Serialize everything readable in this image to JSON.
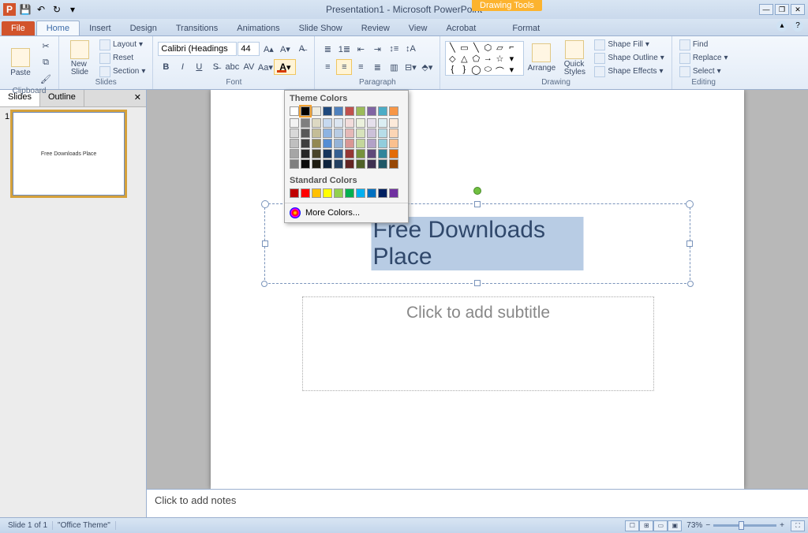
{
  "title": "Presentation1 - Microsoft PowerPoint",
  "context_tab": "Drawing Tools",
  "tabs": {
    "file": "File",
    "home": "Home",
    "insert": "Insert",
    "design": "Design",
    "transitions": "Transitions",
    "animations": "Animations",
    "slideshow": "Slide Show",
    "review": "Review",
    "view": "View",
    "acrobat": "Acrobat",
    "format": "Format"
  },
  "groups": {
    "clipboard": "Clipboard",
    "slides": "Slides",
    "font": "Font",
    "paragraph": "Paragraph",
    "drawing": "Drawing",
    "editing": "Editing"
  },
  "clipboard": {
    "paste": "Paste"
  },
  "slides": {
    "new": "New\nSlide",
    "layout": "Layout",
    "reset": "Reset",
    "section": "Section"
  },
  "font": {
    "name": "Calibri (Headings",
    "size": "44"
  },
  "drawing": {
    "arrange": "Arrange",
    "quick": "Quick\nStyles",
    "fill": "Shape Fill",
    "outline": "Shape Outline",
    "effects": "Shape Effects"
  },
  "editing": {
    "find": "Find",
    "replace": "Replace",
    "select": "Select"
  },
  "color_popup": {
    "theme_heading": "Theme Colors",
    "standard_heading": "Standard Colors",
    "more": "More Colors...",
    "theme_row": [
      "#ffffff",
      "#000000",
      "#eeece1",
      "#1f497d",
      "#4f81bd",
      "#c0504d",
      "#9bbb59",
      "#8064a2",
      "#4bacc6",
      "#f79646"
    ],
    "theme_tints": [
      [
        "#f2f2f2",
        "#7f7f7f",
        "#ddd9c3",
        "#c6d9f0",
        "#dbe5f1",
        "#f2dcdb",
        "#ebf1dd",
        "#e5e0ec",
        "#dbeef3",
        "#fdeada"
      ],
      [
        "#d8d8d8",
        "#595959",
        "#c4bd97",
        "#8db3e2",
        "#b8cce4",
        "#e5b9b7",
        "#d7e3bc",
        "#ccc1d9",
        "#b7dde8",
        "#fbd5b5"
      ],
      [
        "#bfbfbf",
        "#3f3f3f",
        "#938953",
        "#548dd4",
        "#95b3d7",
        "#d99694",
        "#c3d69b",
        "#b2a2c7",
        "#92cddc",
        "#fac08f"
      ],
      [
        "#a5a5a5",
        "#262626",
        "#494429",
        "#17365d",
        "#366092",
        "#953734",
        "#76923c",
        "#5f497a",
        "#31859b",
        "#e36c09"
      ],
      [
        "#7f7f7f",
        "#0c0c0c",
        "#1d1b10",
        "#0f243e",
        "#244061",
        "#632423",
        "#4f6128",
        "#3f3151",
        "#205867",
        "#974806"
      ]
    ],
    "standard": [
      "#c00000",
      "#ff0000",
      "#ffc000",
      "#ffff00",
      "#92d050",
      "#00b050",
      "#00b0f0",
      "#0070c0",
      "#002060",
      "#7030a0"
    ]
  },
  "side": {
    "slides_tab": "Slides",
    "outline_tab": "Outline",
    "thumb_num": "1",
    "thumb_title": "Free Downloads Place"
  },
  "slide": {
    "title": "Free Downloads Place",
    "subtitle_placeholder": "Click to add subtitle"
  },
  "notes_placeholder": "Click to add notes",
  "status": {
    "slide": "Slide 1 of 1",
    "theme": "\"Office Theme\"",
    "zoom": "73%"
  }
}
